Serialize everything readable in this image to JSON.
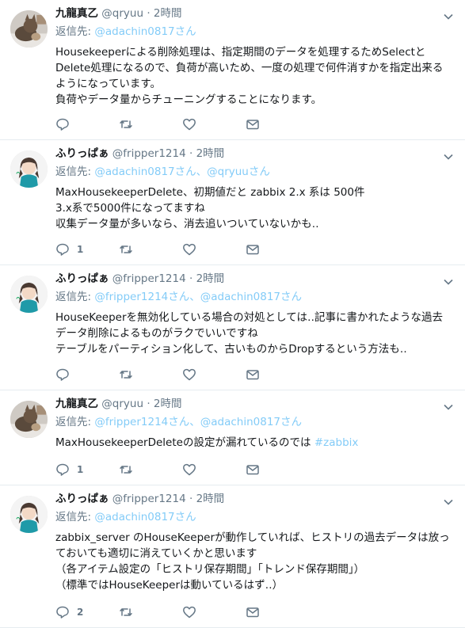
{
  "colors": {
    "accent": "#1da1f2",
    "secondary_text": "#657786",
    "divider": "#e6ecf0"
  },
  "tweets": [
    {
      "name": "九龍真乙",
      "handle": "@qryuu",
      "time": "· 2時間",
      "reply_prefix": "返信先:",
      "reply_to": [
        "@adachin0817さん"
      ],
      "text": "Housekeeperによる削除処理は、指定期間のデータを処理するためSelectと\nDelete処理になるので、負荷が高いため、一度の処理で何件消すかを指定出来る\nようになっています。\n負荷やデータ量からチューニングすることになります。",
      "hashtag": "",
      "reply_count": "",
      "avatar": "cat-photo-avatar"
    },
    {
      "name": "ふりっぱぁ",
      "handle": "@fripper1214",
      "time": "· 2時間",
      "reply_prefix": "返信先:",
      "reply_to": [
        "@adachin0817さん、",
        "@qryuuさん"
      ],
      "text": "MaxHousekeeperDelete、初期値だと zabbix 2.x 系は 500件\n3.x系で5000件になってますね\n収集データ量が多いなら、消去追いついていないかも‥",
      "hashtag": "",
      "reply_count": "1",
      "avatar": "anime-character-avatar"
    },
    {
      "name": "ふりっぱぁ",
      "handle": "@fripper1214",
      "time": "· 2時間",
      "reply_prefix": "返信先:",
      "reply_to": [
        "@fripper1214さん、",
        "@adachin0817さん"
      ],
      "text": "HouseKeeperを無効化している場合の対処としては‥記事に書かれたような過去\nデータ削除によるものがラクでいいですね\nテーブルをパーティション化して、古いものからDropするという方法も‥",
      "hashtag": "",
      "reply_count": "",
      "avatar": "anime-character-avatar"
    },
    {
      "name": "九龍真乙",
      "handle": "@qryuu",
      "time": "· 2時間",
      "reply_prefix": "返信先:",
      "reply_to": [
        "@fripper1214さん、",
        "@adachin0817さん"
      ],
      "text": "MaxHousekeeperDeleteの設定が漏れているのでは ",
      "hashtag": "#zabbix",
      "reply_count": "1",
      "avatar": "cat-photo-avatar"
    },
    {
      "name": "ふりっぱぁ",
      "handle": "@fripper1214",
      "time": "· 2時間",
      "reply_prefix": "返信先:",
      "reply_to": [
        "@adachin0817さん"
      ],
      "text": "zabbix_server のHouseKeeperが動作していれば、ヒストリの過去データは放っ\nておいても適切に消えていくかと思います\n（各アイテム設定の「ヒストリ保存期間」「トレンド保存期間」）\n（標準ではHouseKeeperは動いているはず‥）",
      "hashtag": "",
      "reply_count": "2",
      "avatar": "anime-character-avatar"
    }
  ]
}
